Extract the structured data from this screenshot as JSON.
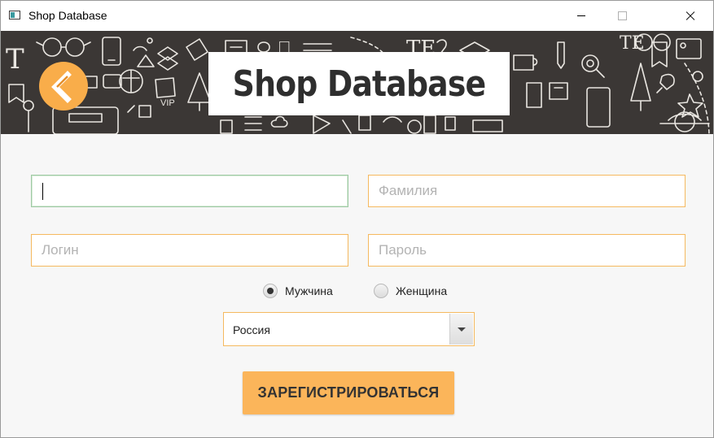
{
  "window": {
    "title": "Shop Database"
  },
  "banner": {
    "title": "Shop Database"
  },
  "form": {
    "name_value": "",
    "surname_placeholder": "Фамилия",
    "login_placeholder": "Логин",
    "password_placeholder": "Пароль",
    "gender": {
      "male_label": "Мужчина",
      "female_label": "Женщина",
      "selected": "male"
    },
    "country": {
      "selected": "Россия"
    },
    "register_label": "ЗАРЕГИСТРИРОВАТЬСЯ"
  },
  "colors": {
    "accent": "#fbb55a",
    "banner_bg": "#3b3735",
    "focus_border": "#9ec9a3"
  }
}
